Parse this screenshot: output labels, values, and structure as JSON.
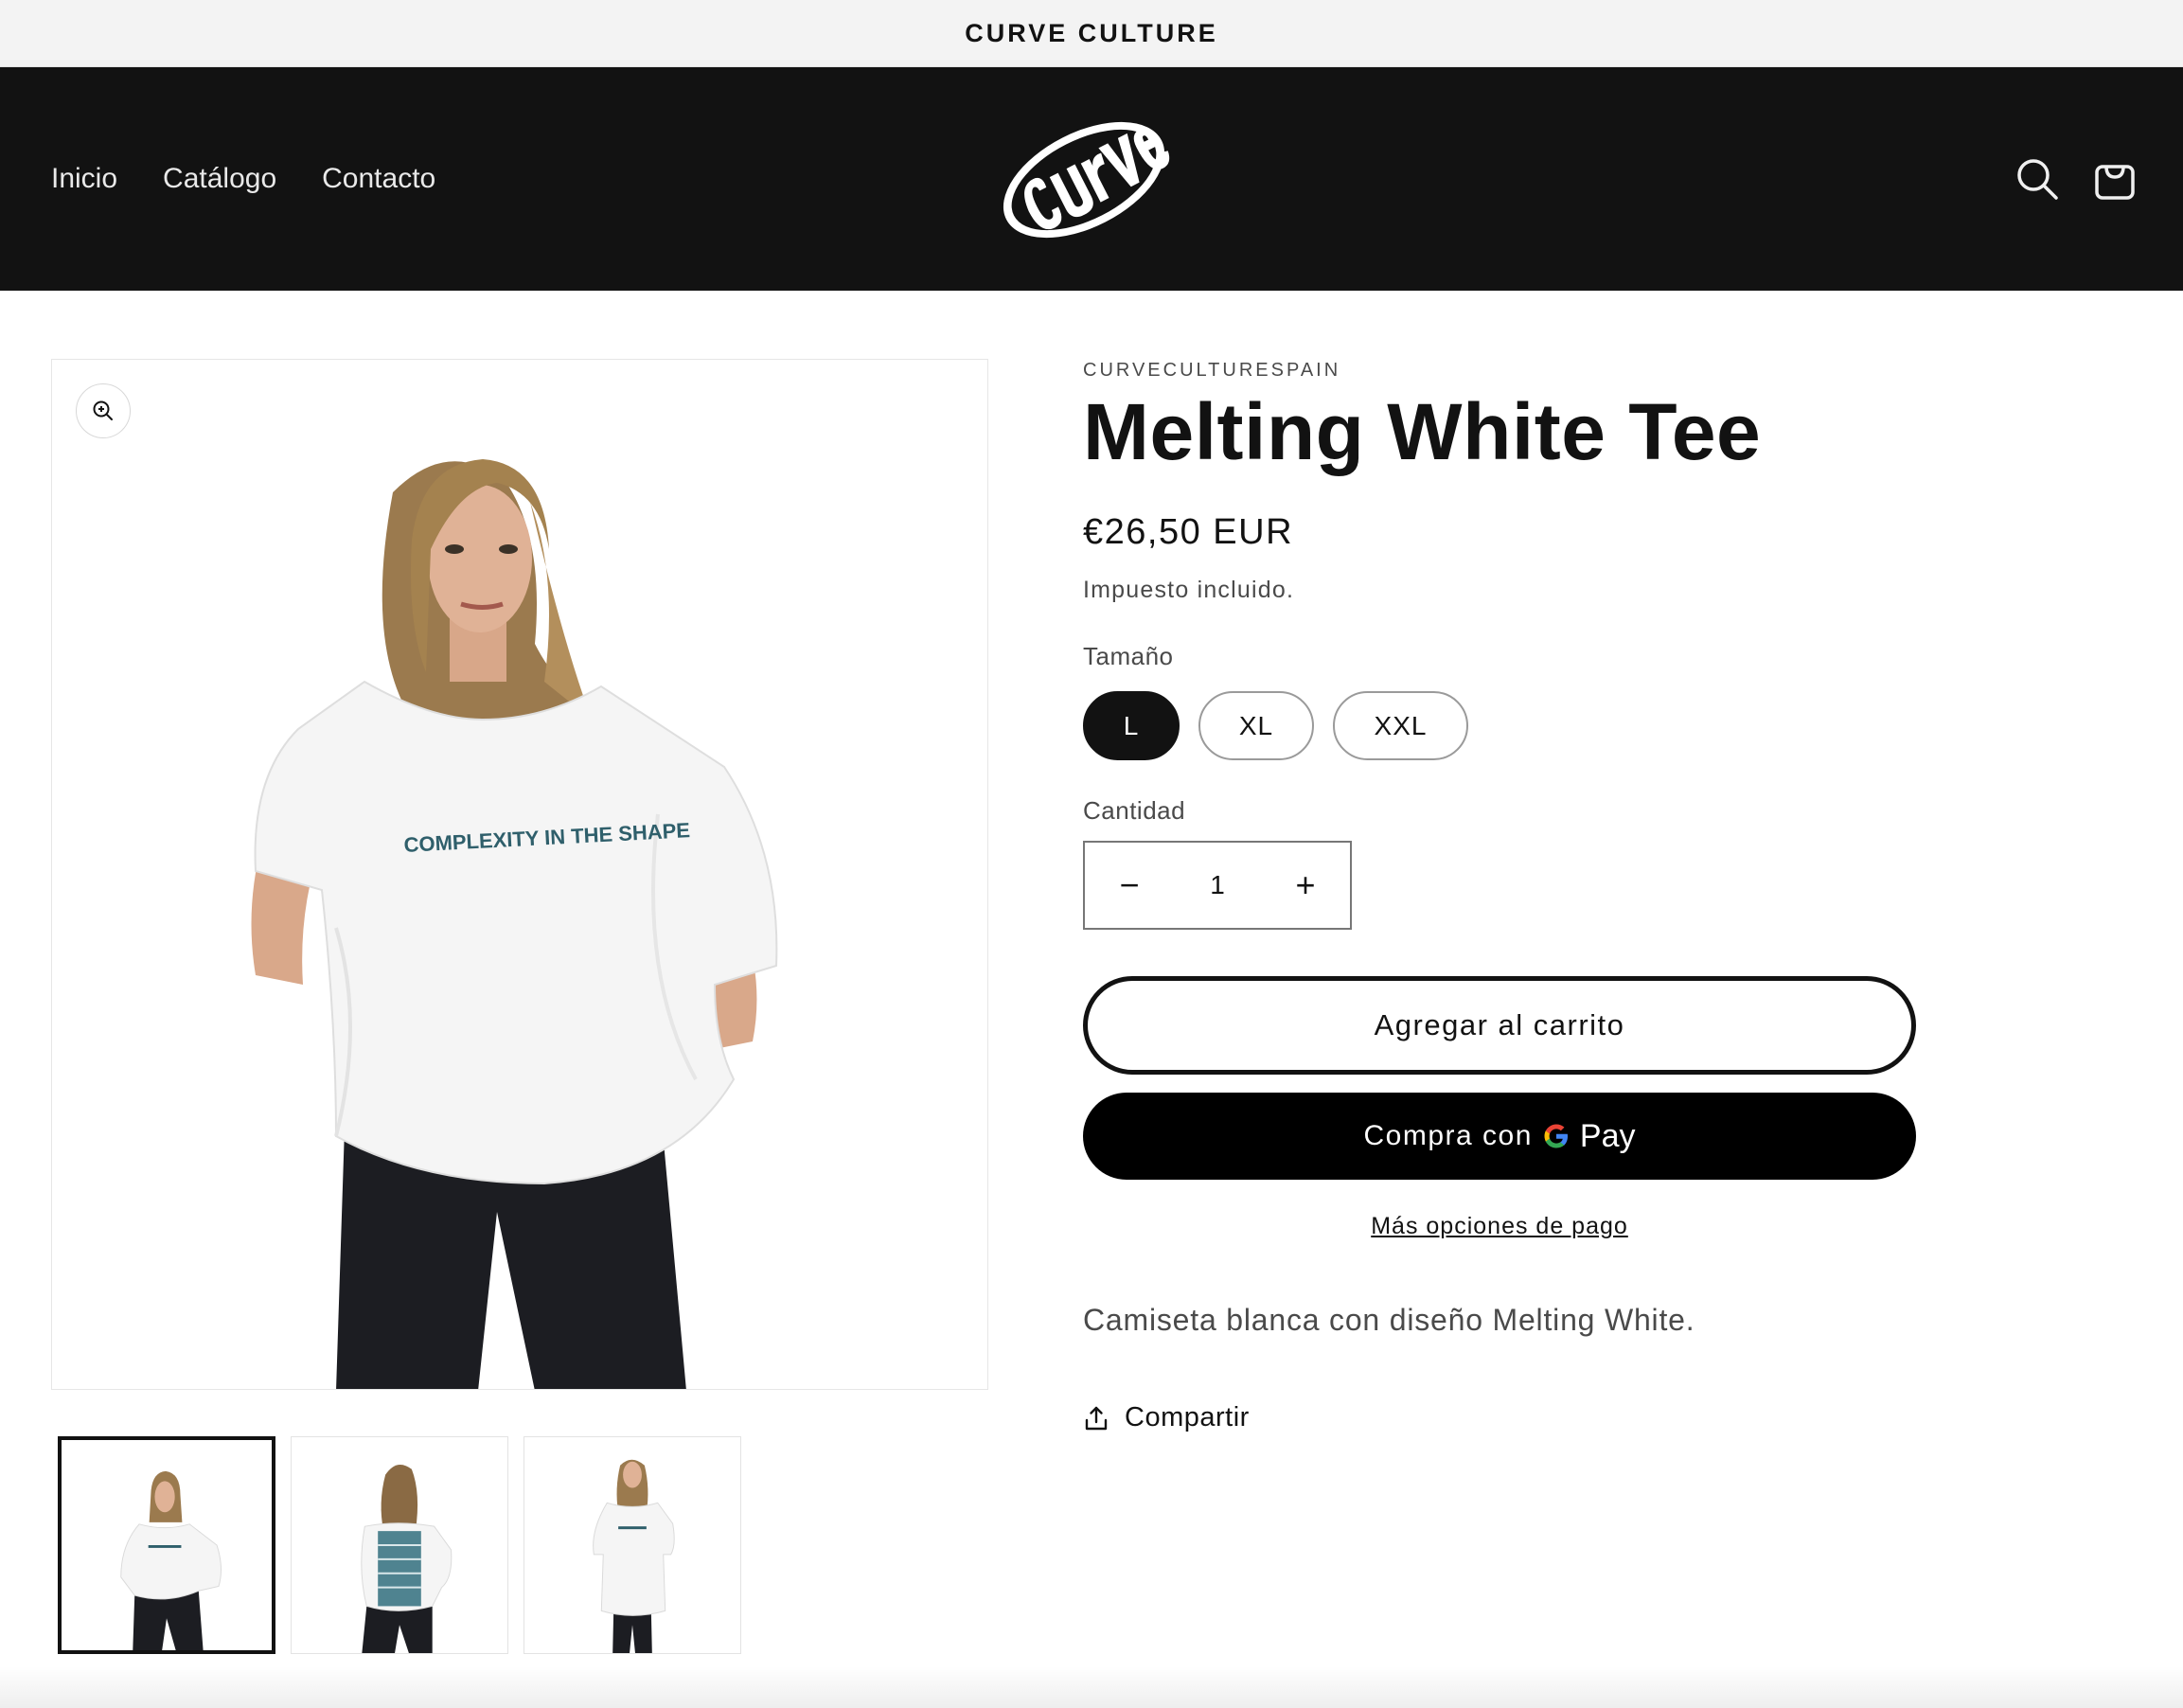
{
  "announcement": {
    "text": "CURVE CULTURE"
  },
  "header": {
    "nav": [
      "Inicio",
      "Catálogo",
      "Contacto"
    ],
    "logo_text": "curve",
    "icons": {
      "search": "search-icon",
      "cart": "cart-icon"
    }
  },
  "gallery": {
    "main_print_text": "COMPLEXITY IN THE SHAPE",
    "zoom_icon": "zoom-in-icon",
    "thumbnails": [
      "front-view",
      "back-view",
      "full-front-view"
    ],
    "active_thumbnail": 0
  },
  "product": {
    "vendor": "CURVECULTURESPAIN",
    "title": "Melting White Tee",
    "price": "€26,50 EUR",
    "tax_note": "Impuesto incluido.",
    "size_label": "Tamaño",
    "sizes": [
      "L",
      "XL",
      "XXL"
    ],
    "selected_size": "L",
    "quantity_label": "Cantidad",
    "quantity": "1",
    "add_to_cart": "Agregar al carrito",
    "buy_with": "Compra con",
    "gpay_g": "G",
    "gpay_pay": "Pay",
    "more_payment": "Más opciones de pago",
    "description": "Camiseta blanca con diseño Melting White.",
    "share": "Compartir"
  },
  "colors": {
    "dark": "#121212",
    "announce_bg": "#f3f3f3",
    "accent_teal": "#2f5f6b"
  }
}
